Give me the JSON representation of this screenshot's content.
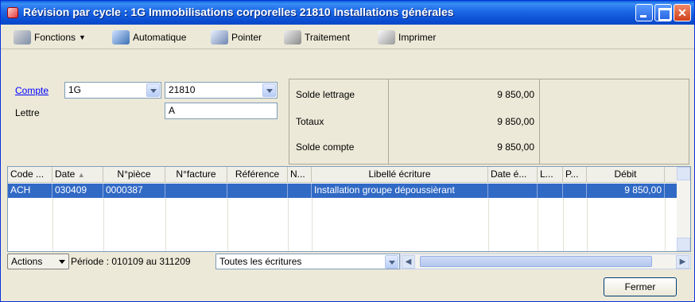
{
  "window": {
    "title": "Révision par cycle : 1G Immobilisations corporelles 21810 Installations générales"
  },
  "toolbar": {
    "fonctions": "Fonctions",
    "automatique": "Automatique",
    "pointer": "Pointer",
    "traitement": "Traitement",
    "imprimer": "Imprimer"
  },
  "form": {
    "compte_label": "Compte",
    "compte_cycle": "1G",
    "compte_number": "21810",
    "lettre_label": "Lettre",
    "lettre_value": "A"
  },
  "summary": [
    {
      "label": "Solde lettrage",
      "value": "9 850,00"
    },
    {
      "label": "Totaux",
      "value": "9 850,00"
    },
    {
      "label": "Solde compte",
      "value": "9 850,00"
    }
  ],
  "table": {
    "headers": [
      "Code ...",
      "Date",
      "N°pièce",
      "N°facture",
      "Référence",
      "N...",
      "Libellé écriture",
      "Date é...",
      "L...",
      "P...",
      "Débit"
    ],
    "rows": [
      [
        "ACH",
        "030409",
        "0000387",
        "",
        "",
        "",
        "Installation groupe dépoussièrant",
        "",
        "",
        "",
        "9 850,00"
      ]
    ]
  },
  "bottom": {
    "actions": "Actions",
    "periode": "Période : 010109 au 311209",
    "filter": "Toutes les écritures"
  },
  "buttons": {
    "fermer": "Fermer"
  }
}
